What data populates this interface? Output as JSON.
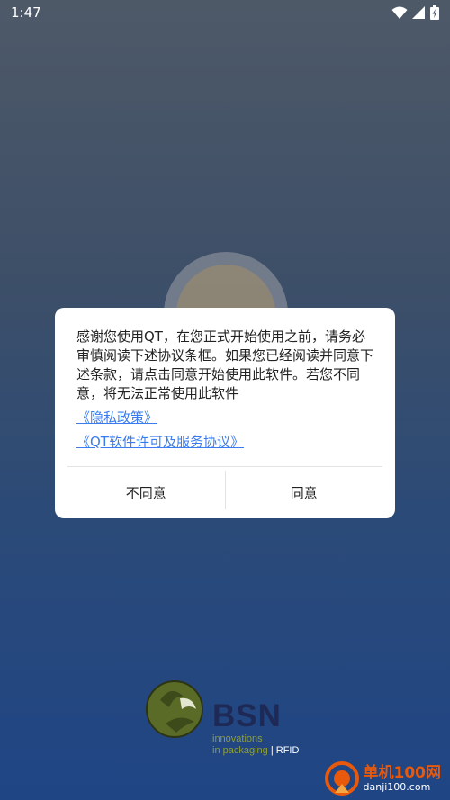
{
  "status_bar": {
    "time": "1:47",
    "icons": [
      "wifi-icon",
      "signal-icon",
      "battery-charging-icon"
    ]
  },
  "dialog": {
    "message": "感谢您使用QT，在您正式开始使用之前，请务必审慎阅读下述协议条框。如果您已经阅读并同意下述条款，请点击同意开始使用此软件。若您不同意，将无法正常使用此软件",
    "links": [
      "《隐私政策》",
      "《QT软件许可及服务协议》"
    ],
    "disagree_label": "不同意",
    "agree_label": "同意",
    "link_color": "#3a7cf0"
  },
  "brand": {
    "name": "BSN",
    "tagline_line1": "innovations",
    "tagline_line2": "in packaging",
    "tagline_suffix": "| RFID"
  },
  "watermark": {
    "name": "单机100网",
    "url": "danji100.com",
    "accent": "#e8590c"
  }
}
